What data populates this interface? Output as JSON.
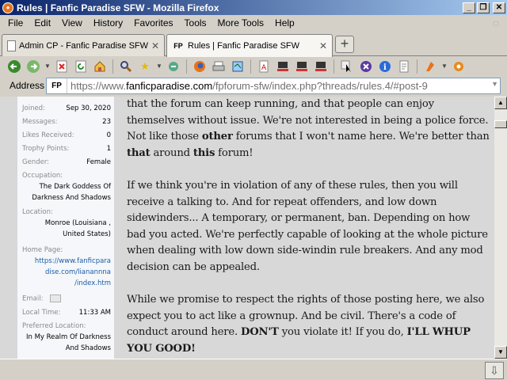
{
  "window": {
    "title": "Rules | Fanfic Paradise SFW - Mozilla Firefox",
    "icon": "firefox-icon"
  },
  "menu": [
    "File",
    "Edit",
    "View",
    "History",
    "Favorites",
    "Tools",
    "More Tools",
    "Help"
  ],
  "tabs": [
    {
      "label": "Admin CP - Fanfic Paradise SFW",
      "favicon": "",
      "active": false
    },
    {
      "label": "Rules | Fanfic Paradise SFW",
      "favicon": "FP",
      "active": true
    }
  ],
  "toolbar": {
    "icons": [
      "back-icon",
      "forward-icon",
      "stop-icon",
      "reload-icon",
      "home-icon",
      "search-icon",
      "bookmark-star-icon",
      "refresh-icon",
      "firefox-icon",
      "print-icon",
      "page-icon",
      "pdf-icon",
      "computer-icon",
      "computer-icon",
      "computer-icon",
      "cursor-icon",
      "close-icon",
      "info-icon",
      "notes-icon",
      "addon-icon",
      "settings-icon"
    ]
  },
  "address": {
    "label": "Address",
    "favicon": "FP",
    "url_prefix": "https://www.",
    "url_host": "fanficparadise.com",
    "url_path": "/fpforum-sfw/index.php?threads/rules.4/#post-9"
  },
  "sidebar": {
    "pairs": [
      {
        "label": "Joined:",
        "value": "Sep 30, 2020"
      },
      {
        "label": "Messages:",
        "value": "23"
      },
      {
        "label": "Likes Received:",
        "value": "0"
      },
      {
        "label": "Trophy Points:",
        "value": "1"
      },
      {
        "label": "Gender:",
        "value": "Female"
      }
    ],
    "occupation": {
      "label": "Occupation:",
      "lines": [
        "The Dark Goddess Of",
        "Darkness And Shadows"
      ]
    },
    "location": {
      "label": "Location:",
      "lines": [
        "Monroe (Louisiana ,",
        "United States)"
      ]
    },
    "homepage": {
      "label": "Home Page:",
      "lines": [
        "https://www.fanficpara",
        "dise.com/lianannna",
        "/index.htm"
      ]
    },
    "email": {
      "label": "Email:"
    },
    "localtime": {
      "label": "Local Time:",
      "value": "11:33 AM"
    },
    "preferred": {
      "label": "Preferred Location:",
      "lines": [
        "In My Realm Of Darkness",
        "And Shadows"
      ]
    }
  },
  "post": {
    "p1": {
      "a": "that the forum can keep running, and that people can enjoy themselves without issue. We're not interested in being a police force. Not like those ",
      "b1": "other",
      "c": " forums that I won't name here. We're better than ",
      "b2": "that",
      "d": " around ",
      "b3": "this",
      "e": " forum!"
    },
    "p2": "If we think you're in violation of any of these rules, then you will receive a talking to. And for repeat offenders, and low down sidewinders... A temporary, or permanent, ban. Depending on how bad you acted. We're perfectly capable of looking at the whole picture when dealing with low down side-windin rule breakers. And any mod decision can be appealed.",
    "p3": {
      "a": "While we promise to respect the rights of those posting here, we also expect you to act like a grownup. And be civil. There's a code of conduct around here. ",
      "b1": "DON'T",
      "c": " you violate it! If you do, ",
      "b2": "I'LL WHUP YOU GOOD!"
    }
  }
}
